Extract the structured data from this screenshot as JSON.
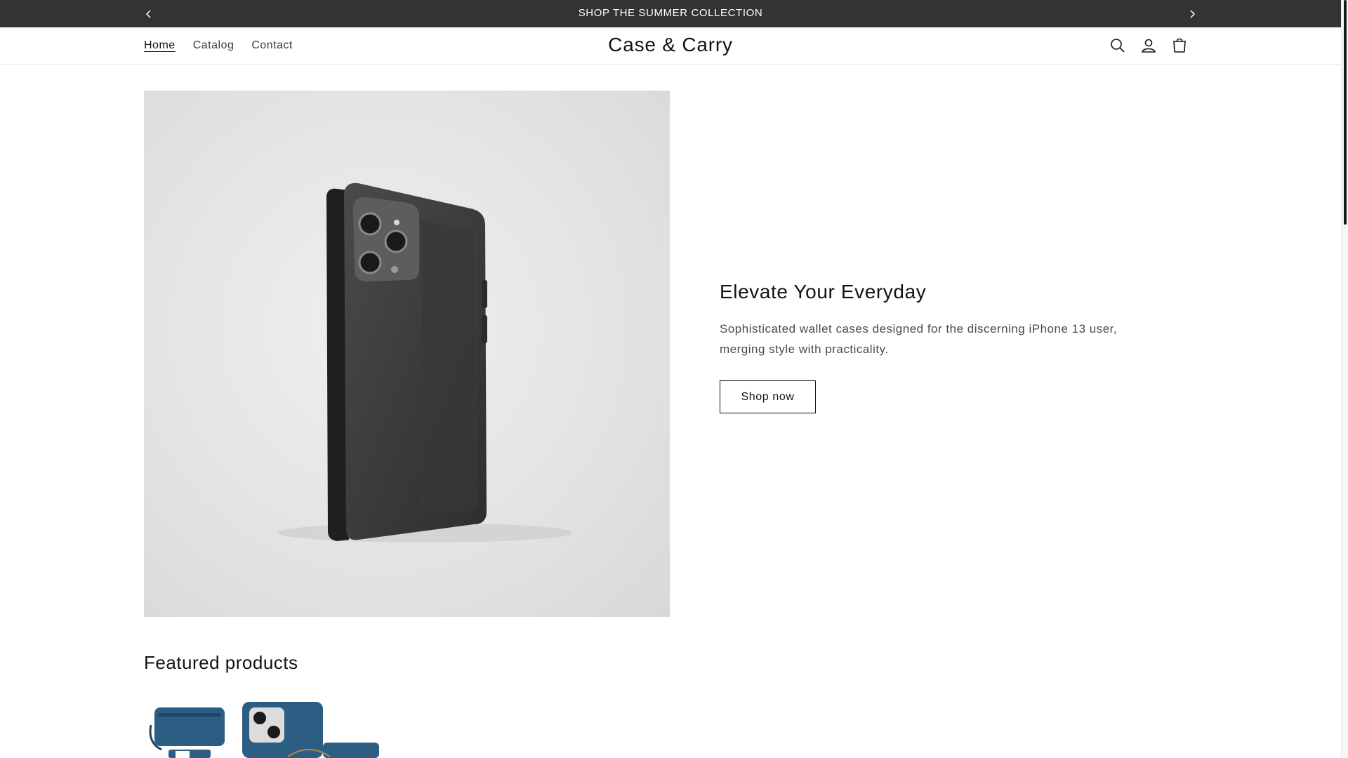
{
  "announcement": {
    "text": "SHOP THE SUMMER COLLECTION",
    "prev_icon": "chevron-left-icon",
    "next_icon": "chevron-right-icon"
  },
  "header": {
    "nav": [
      {
        "label": "Home",
        "active": true
      },
      {
        "label": "Catalog",
        "active": false
      },
      {
        "label": "Contact",
        "active": false
      }
    ],
    "logo": "Case & Carry",
    "icons": [
      "search-icon",
      "account-icon",
      "cart-icon"
    ]
  },
  "hero": {
    "title": "Elevate Your Everyday",
    "description": "Sophisticated wallet cases designed for the discerning iPhone 13 user, merging style with practicality.",
    "button_label": "Shop now"
  },
  "featured": {
    "title": "Featured products"
  },
  "colors": {
    "announcement_bg": "#333333",
    "text": "#121212",
    "product_blue": "#2c5d82"
  }
}
